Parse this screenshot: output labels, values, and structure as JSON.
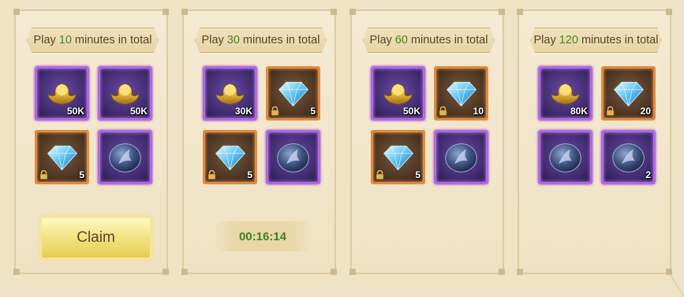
{
  "panels": [
    {
      "title_prefix": "Play",
      "minutes": "10",
      "title_suffix": "minutes in total",
      "items": [
        {
          "type": "gold-ingot-icon",
          "rarity": "purple",
          "qty": "50K",
          "locked": false
        },
        {
          "type": "gold-ingot-icon",
          "rarity": "purple",
          "qty": "50K",
          "locked": false
        },
        {
          "type": "diamond-icon",
          "rarity": "orange",
          "qty": "5",
          "locked": true
        },
        {
          "type": "stone-emblem-icon",
          "rarity": "purple",
          "qty": "",
          "locked": false
        }
      ],
      "action": {
        "kind": "button",
        "label": "Claim"
      }
    },
    {
      "title_prefix": "Play",
      "minutes": "30",
      "title_suffix": "minutes in total",
      "items": [
        {
          "type": "gold-ingot-icon",
          "rarity": "purple",
          "qty": "30K",
          "locked": false
        },
        {
          "type": "diamond-icon",
          "rarity": "orange",
          "qty": "5",
          "locked": true
        },
        {
          "type": "diamond-icon",
          "rarity": "orange",
          "qty": "5",
          "locked": true
        },
        {
          "type": "stone-emblem-icon",
          "rarity": "purple",
          "qty": "",
          "locked": false
        }
      ],
      "action": {
        "kind": "timer",
        "label": "00:16:14"
      }
    },
    {
      "title_prefix": "Play",
      "minutes": "60",
      "title_suffix": "minutes in total",
      "items": [
        {
          "type": "gold-ingot-icon",
          "rarity": "purple",
          "qty": "50K",
          "locked": false
        },
        {
          "type": "diamond-icon",
          "rarity": "orange",
          "qty": "10",
          "locked": true
        },
        {
          "type": "diamond-icon",
          "rarity": "orange",
          "qty": "5",
          "locked": true
        },
        {
          "type": "stone-emblem-icon",
          "rarity": "purple",
          "qty": "",
          "locked": false
        }
      ],
      "action": null
    },
    {
      "title_prefix": "Play",
      "minutes": "120",
      "title_suffix": "minutes in total",
      "items": [
        {
          "type": "gold-ingot-icon",
          "rarity": "purple",
          "qty": "80K",
          "locked": false
        },
        {
          "type": "diamond-icon",
          "rarity": "orange",
          "qty": "20",
          "locked": true
        },
        {
          "type": "stone-emblem-icon",
          "rarity": "purple",
          "qty": "",
          "locked": false
        },
        {
          "type": "stone-emblem-icon",
          "rarity": "purple",
          "qty": "2",
          "locked": false
        }
      ],
      "action": null
    }
  ],
  "colors": {
    "minutes_highlight": "#3f8a1f",
    "purple_frame": "#b367e8",
    "orange_frame": "#e38a3b",
    "claim_button": "#f1e07a",
    "timer_text": "#3f7f22"
  }
}
